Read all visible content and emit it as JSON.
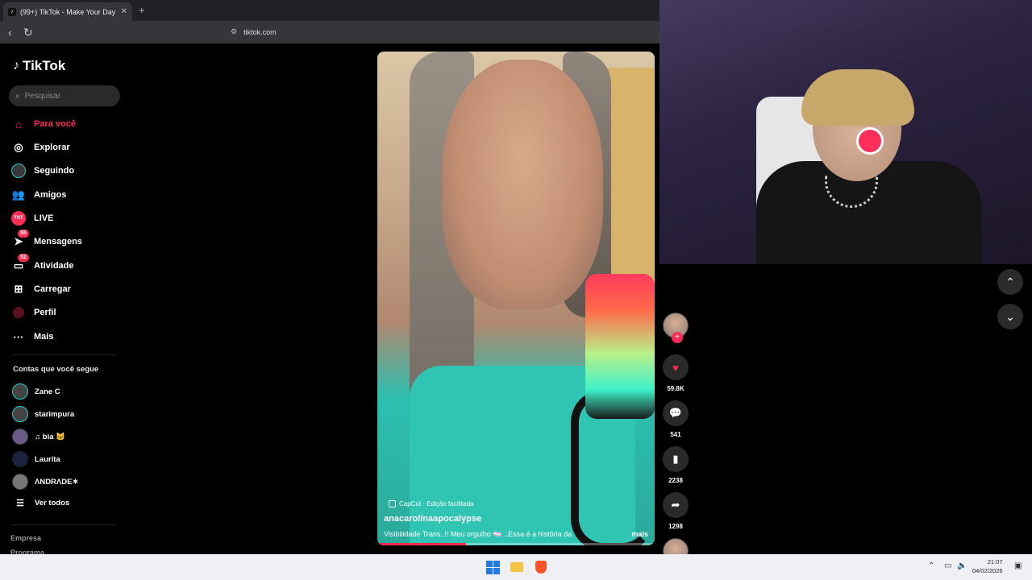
{
  "browser": {
    "tab_title": "(99+) TikTok - Make Your Day",
    "tab_close": "✕",
    "new_tab": "+",
    "url": "tiktok.com"
  },
  "sidebar": {
    "logo": "TikTok",
    "search_placeholder": "Pesquisar",
    "menu": [
      {
        "label": "Para você",
        "icon": "home-icon"
      },
      {
        "label": "Explorar",
        "icon": "compass-icon"
      },
      {
        "label": "Seguindo",
        "icon": "following-avatar-icon"
      },
      {
        "label": "Amigos",
        "icon": "friends-icon"
      },
      {
        "label": "LIVE",
        "icon": "live-icon"
      },
      {
        "label": "Mensagens",
        "icon": "messages-icon",
        "badge": "55"
      },
      {
        "label": "Atividade",
        "icon": "activity-icon",
        "badge": "52"
      },
      {
        "label": "Carregar",
        "icon": "upload-icon"
      },
      {
        "label": "Perfil",
        "icon": "profile-icon"
      },
      {
        "label": "Mais",
        "icon": "more-icon"
      }
    ],
    "live_badge_text": "TNT",
    "following_title": "Contas que você segue",
    "following": [
      {
        "name": "Zane C"
      },
      {
        "name": "starimpura"
      },
      {
        "name": "♫ bia 🐱"
      },
      {
        "name": "Laurita"
      },
      {
        "name": "ΛNDRΛDE✶"
      }
    ],
    "see_all": "Ver todos",
    "footer": [
      "Empresa",
      "Programa"
    ]
  },
  "video": {
    "capcut_label": "CapCut · Edição facilitada",
    "author": "anacarolinaapocalypse",
    "description": "Visibilidade Trans..!! Meu orgulho 🏳️‍⚧️ ..Essa é a história da",
    "more": "mais",
    "progress": 0.32
  },
  "actions": {
    "likes": "59.8K",
    "comments": "541",
    "saves": "2238",
    "shares": "1298"
  },
  "taskbar": {
    "time": "21:07",
    "date": "04/02/2026"
  },
  "colors": {
    "accent": "#fe2c55",
    "background": "#000000",
    "taskbar": "#eef0f3"
  }
}
